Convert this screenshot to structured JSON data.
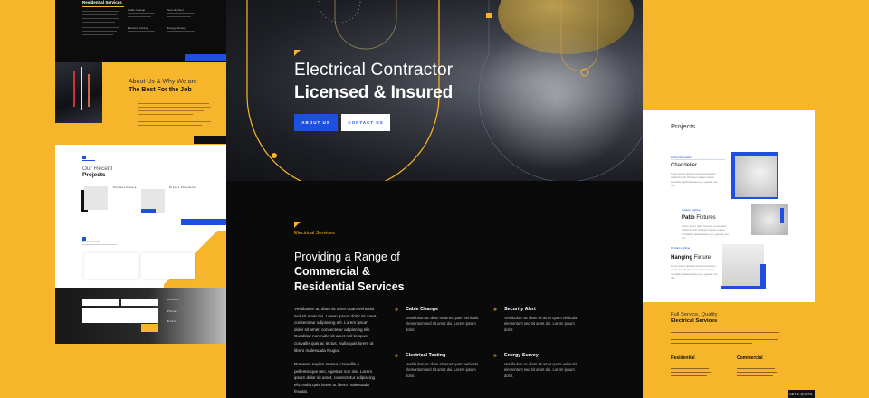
{
  "colors": {
    "accent_yellow": "#f7b52c",
    "accent_blue": "#1d4fe0",
    "dark": "#0a0a0b"
  },
  "left_mockup": {
    "services_title": "Residential Services",
    "services": [
      "Cable Change",
      "Security Alert",
      "Electrical Testing",
      "Energy Survey"
    ],
    "about_heading": "About Us & Why We are",
    "about_strong": "The Best For the Job",
    "recent_heading": "Our Recent",
    "recent_strong": "Projects",
    "project_names": [
      "Pendant Fixture",
      "Orange Chandelier"
    ],
    "testimonials_label": "Testimonials",
    "contact_labels": [
      "Address",
      "Phone",
      "Email"
    ]
  },
  "hero": {
    "title_line1": "Electrical Contractor",
    "title_line2": "Licensed & Insured",
    "about_button": "ABOUT US",
    "contact_button": "CONTACT US"
  },
  "services": {
    "tag": "Electrical Services",
    "heading_line1": "Providing a Range of",
    "heading_line2": "Commercial &",
    "heading_line3": "Residential Services",
    "paragraph1": "Vestibulum ac diam sit amet quam vehicula sed sit amet dui. Lorem ipsum dolor sit amet, consectetur adipiscing elit. Lorem ipsum dolor sit amet, consectetur adipiscing elit. Curabitur non nulla sit amet nisl tempus convallis quis ac lectus. Nulla quis lorem ut libero malesuada feugiat.",
    "paragraph2": "Praesent sapien massa, convallis a pellentesque nec, egestas non nisi. Lorem ipsum dolor sit amet, consectetur adipiscing elit. Nulla quis lorem ut libero malesuada feugiat.",
    "features": [
      {
        "title": "Cable Change",
        "desc": "Vestibulum ac diam sit amet quam vehicula elementum sed sit amet dui. Lorem ipsum dolor."
      },
      {
        "title": "Security Alert",
        "desc": "Vestibulum ac diam sit amet quam vehicula elementum sed sit amet dui. Lorem ipsum dolor."
      },
      {
        "title": "Electrical Testing",
        "desc": "Vestibulum ac diam sit amet quam vehicula elementum sed sit amet dui. Lorem ipsum dolor."
      },
      {
        "title": "Energy Survey",
        "desc": "Vestibulum ac diam sit amet quam vehicula elementum sed sit amet dui. Lorem ipsum dolor."
      }
    ]
  },
  "right_mockup": {
    "projects_title": "Projects",
    "projects": [
      {
        "tag": "Ceiling Illumination",
        "name": "Chandelier",
        "name_strong": "",
        "name_rest": ""
      },
      {
        "tag": "Outdoor Lighting",
        "name": "",
        "name_strong": "Patio",
        "name_rest": " Fixtures"
      },
      {
        "tag": "Pendant Lighting",
        "name": "",
        "name_strong": "Hanging",
        "name_rest": " Fixture"
      }
    ],
    "project_desc": "Lorem ipsum dolor sit amet, consectetur adipiscing elit. Praesent sapien massa, convallis a pellentesque nec, egestas non nisi.",
    "fullservice_line1": "Full Service, Quality",
    "fullservice_line2": "Electrical Services",
    "col1": "Residential",
    "col2": "Commercial",
    "bottom_button": "GET A QUOTE"
  }
}
